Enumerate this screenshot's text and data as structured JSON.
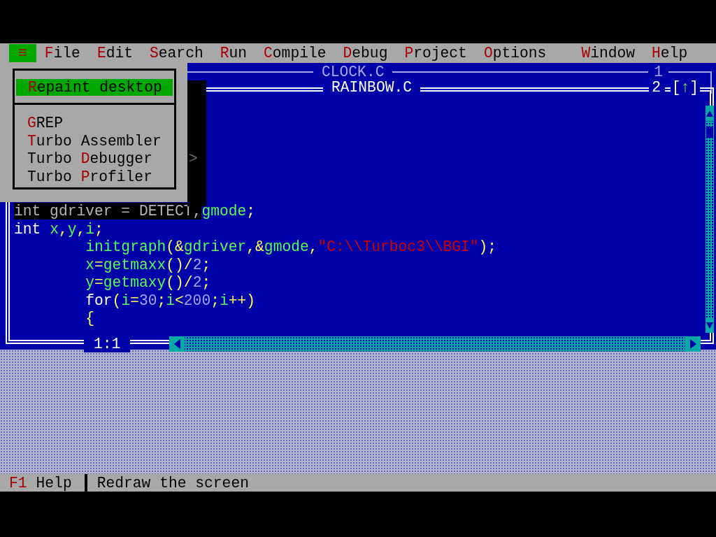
{
  "menu_bar": [
    {
      "hot": "≡",
      "selected": true
    },
    {
      "hot": "F",
      "post": "ile",
      "selected": false
    },
    {
      "hot": "E",
      "post": "dit",
      "selected": false
    },
    {
      "hot": "S",
      "post": "earch",
      "selected": false
    },
    {
      "hot": "R",
      "post": "un",
      "selected": false
    },
    {
      "hot": "C",
      "post": "ompile",
      "selected": false
    },
    {
      "hot": "D",
      "post": "ebug",
      "selected": false
    },
    {
      "hot": "P",
      "post": "roject",
      "selected": false
    },
    {
      "hot": "O",
      "post": "ptions",
      "selected": false
    },
    {
      "hot": "W",
      "post": "indow",
      "selected": false
    },
    {
      "hot": "H",
      "post": "elp",
      "selected": false
    }
  ],
  "system_menu": {
    "groups": [
      [
        {
          "hot": "R",
          "post": "epaint desktop",
          "selected": true
        }
      ],
      [
        {
          "hot": "G",
          "post": "REP",
          "selected": false
        },
        {
          "hot": "T",
          "post": "urbo Assembler",
          "selected": false
        },
        {
          "pre": "Turbo ",
          "hot": "D",
          "post": "ebugger",
          "selected": false
        },
        {
          "pre": "Turbo ",
          "hot": "P",
          "post": "rofiler",
          "selected": false
        }
      ]
    ]
  },
  "windows": [
    {
      "title": "CLOCK.C",
      "number": "1",
      "active": false
    },
    {
      "title": "RAINBOW.C",
      "number": "2",
      "active": true,
      "zoom_open": "[",
      "zoom_arrow": "↑",
      "zoom_close": "]"
    }
  ],
  "shadow_glyph": ">",
  "code": [
    {
      "segments": [
        {
          "text": "int gdriver = DETECT,",
          "kind": "shadowed"
        },
        {
          "text": "gmode",
          "kind": "ident"
        },
        {
          "text": ";",
          "kind": "symbol"
        }
      ]
    },
    {
      "segments": [
        {
          "text": "int ",
          "kind": "plain"
        },
        {
          "text": "x",
          "kind": "ident"
        },
        {
          "text": ",",
          "kind": "symbol"
        },
        {
          "text": "y",
          "kind": "ident"
        },
        {
          "text": ",",
          "kind": "symbol"
        },
        {
          "text": "i",
          "kind": "ident"
        },
        {
          "text": ";",
          "kind": "symbol"
        }
      ]
    },
    {
      "segments": [
        {
          "text": "        initgraph",
          "kind": "ident"
        },
        {
          "text": "(&",
          "kind": "symbol"
        },
        {
          "text": "gdriver",
          "kind": "ident"
        },
        {
          "text": ",&",
          "kind": "symbol"
        },
        {
          "text": "gmode",
          "kind": "ident"
        },
        {
          "text": ",",
          "kind": "symbol"
        },
        {
          "text": "\"C:\\\\Turboc3\\\\BGI\"",
          "kind": "string"
        },
        {
          "text": ");",
          "kind": "symbol"
        }
      ]
    },
    {
      "segments": [
        {
          "text": "        x",
          "kind": "ident"
        },
        {
          "text": "=",
          "kind": "symbol"
        },
        {
          "text": "getmaxx",
          "kind": "ident"
        },
        {
          "text": "()/",
          "kind": "symbol"
        },
        {
          "text": "2",
          "kind": "number"
        },
        {
          "text": ";",
          "kind": "symbol"
        }
      ]
    },
    {
      "segments": [
        {
          "text": "        y",
          "kind": "ident"
        },
        {
          "text": "=",
          "kind": "symbol"
        },
        {
          "text": "getmaxy",
          "kind": "ident"
        },
        {
          "text": "()/",
          "kind": "symbol"
        },
        {
          "text": "2",
          "kind": "number"
        },
        {
          "text": ";",
          "kind": "symbol"
        }
      ]
    },
    {
      "segments": [
        {
          "text": "        for",
          "kind": "plain"
        },
        {
          "text": "(",
          "kind": "symbol"
        },
        {
          "text": "i",
          "kind": "ident"
        },
        {
          "text": "=",
          "kind": "symbol"
        },
        {
          "text": "30",
          "kind": "number"
        },
        {
          "text": ";",
          "kind": "symbol"
        },
        {
          "text": "i",
          "kind": "ident"
        },
        {
          "text": "<",
          "kind": "symbol"
        },
        {
          "text": "200",
          "kind": "number"
        },
        {
          "text": ";",
          "kind": "symbol"
        },
        {
          "text": "i",
          "kind": "ident"
        },
        {
          "text": "++)",
          "kind": "symbol"
        }
      ]
    },
    {
      "segments": [
        {
          "text": "        {",
          "kind": "symbol"
        }
      ]
    }
  ],
  "cursor_position": "1:1",
  "status_bar": {
    "key": "F1",
    "key_label": "Help",
    "message": "Redraw the screen"
  }
}
